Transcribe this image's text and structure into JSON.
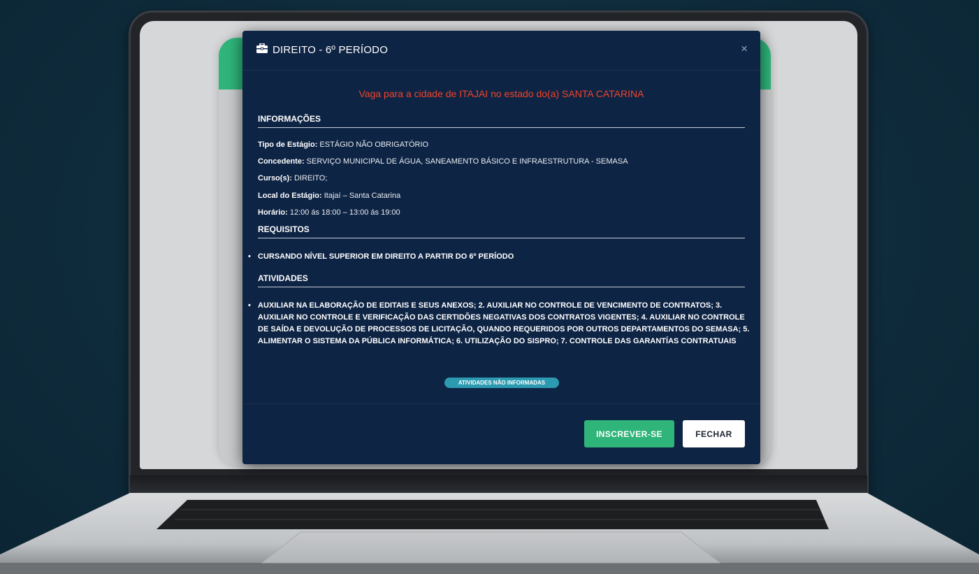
{
  "modal": {
    "title": "DIREITO - 6º PERÍODO",
    "close_label": "×",
    "city_line": "Vaga para a cidade de ITAJAI no estado do(a) SANTA CATARINA",
    "sections": {
      "info": "INFORMAÇÕES",
      "requirements": "REQUISITOS",
      "activities": "ATIVIDADES"
    },
    "info": [
      {
        "label": "Tipo de Estágio:",
        "value": " ESTÁGIO NÃO OBRIGATÓRIO"
      },
      {
        "label": "Concedente:",
        "value": " SERVIÇO MUNICIPAL DE ÁGUA, SANEAMENTO BÁSICO E INFRAESTRUTURA - SEMASA"
      },
      {
        "label": "Curso(s):",
        "value": " DIREITO;"
      },
      {
        "label": "Local do Estágio:",
        "value": " Itajaí – Santa Catarina"
      },
      {
        "label": "Horário:",
        "value": " 12:00 ás 18:00 – 13:00 ás 19:00"
      }
    ],
    "requirements": [
      "CURSANDO NÍVEL SUPERIOR EM DIREITO A PARTIR DO 6º PERÍODO"
    ],
    "activities": [
      "AUXILIAR NA ELABORAÇÃO DE EDITAIS E SEUS ANEXOS; 2. AUXILIAR NO CONTROLE DE VENCIMENTO DE CONTRATOS; 3. AUXILIAR NO CONTROLE E VERIFICAÇÃO DAS CERTIDÕES NEGATIVAS DOS CONTRATOS VIGENTES; 4. AUXILIAR NO CONTROLE DE SAÍDA E DEVOLUÇÃO DE PROCESSOS DE LICITAÇÃO, QUANDO REQUERIDOS POR OUTROS DEPARTAMENTOS DO SEMASA; 5. ALIMENTAR O SISTEMA DA PÚBLICA INFORMÁTICA; 6. UTILIZAÇÃO DO SISPRO; 7. CONTROLE DAS GARANTÍAS CONTRATUAIS"
    ],
    "badge": "ATIVIDADES NÃO INFORMADAS",
    "buttons": {
      "subscribe": "INSCREVER-SE",
      "close": "FECHAR"
    }
  },
  "colors": {
    "modal_bg": "#0e2444",
    "accent_green": "#2fb47a",
    "city_red": "#f0432b",
    "badge_teal": "#2c9ab0"
  },
  "icons": {
    "title": "briefcase-icon",
    "close": "close-icon"
  }
}
